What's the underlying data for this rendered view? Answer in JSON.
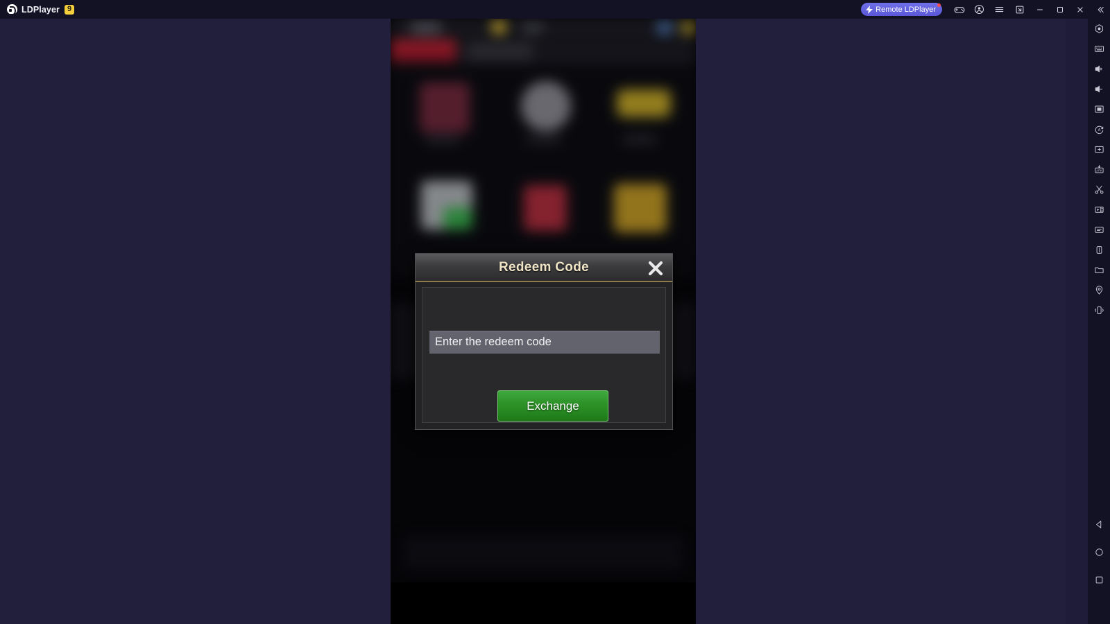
{
  "titlebar": {
    "brand_name": "LDPlayer",
    "version_badge": "9",
    "remote_label": "Remote LDPlayer",
    "buttons": [
      {
        "name": "gamepad-icon",
        "label": "Gamepad"
      },
      {
        "name": "account-icon",
        "label": "Account"
      },
      {
        "name": "menu-icon",
        "label": "Menu"
      },
      {
        "name": "shrink-window-icon",
        "label": "Shrink window"
      },
      {
        "name": "minimize-icon",
        "label": "Minimize"
      },
      {
        "name": "maximize-icon",
        "label": "Maximize"
      },
      {
        "name": "close-icon",
        "label": "Close"
      },
      {
        "name": "collapse-icon",
        "label": "Collapse"
      }
    ]
  },
  "sidebar": {
    "items": [
      {
        "name": "multi-instance-icon",
        "label": "Multi-instance"
      },
      {
        "name": "keyboard-icon",
        "label": "Keyboard mapping"
      },
      {
        "name": "volume-up-icon",
        "label": "Volume up"
      },
      {
        "name": "volume-down-icon",
        "label": "Volume down"
      },
      {
        "name": "fullscreen-icon",
        "label": "Fullscreen"
      },
      {
        "name": "auto-rotate-icon",
        "label": "Rotate screen"
      },
      {
        "name": "screenshot-icon",
        "label": "Screenshot"
      },
      {
        "name": "apk-install-icon",
        "label": "Install APK"
      },
      {
        "name": "scissors-icon",
        "label": "Cut / Clipboard"
      },
      {
        "name": "video-record-icon",
        "label": "Record screen"
      },
      {
        "name": "script-icon",
        "label": "Operation recorder"
      },
      {
        "name": "shake-icon",
        "label": "Shake"
      },
      {
        "name": "folder-icon",
        "label": "Shared folder"
      },
      {
        "name": "location-icon",
        "label": "Virtual location"
      },
      {
        "name": "vibrate-icon",
        "label": "Vibrate"
      }
    ],
    "nav": [
      {
        "name": "android-back-icon",
        "label": "Back"
      },
      {
        "name": "android-home-icon",
        "label": "Home"
      },
      {
        "name": "android-recents-icon",
        "label": "Recents"
      }
    ]
  },
  "dialog": {
    "title": "Redeem Code",
    "close_label": "×",
    "input_placeholder": "Enter the redeem code",
    "input_value": "",
    "submit_label": "Exchange"
  },
  "colors": {
    "window_chrome": "#131124",
    "letterbox": "#211f3c",
    "remote_badge": "#5a58d8",
    "dialog_title_text": "#efe4c6",
    "dialog_title_border": "#8d7c48",
    "input_bg": "#63636d",
    "submit_green": "#2e9429",
    "badge_yellow": "#f5cf3b"
  }
}
